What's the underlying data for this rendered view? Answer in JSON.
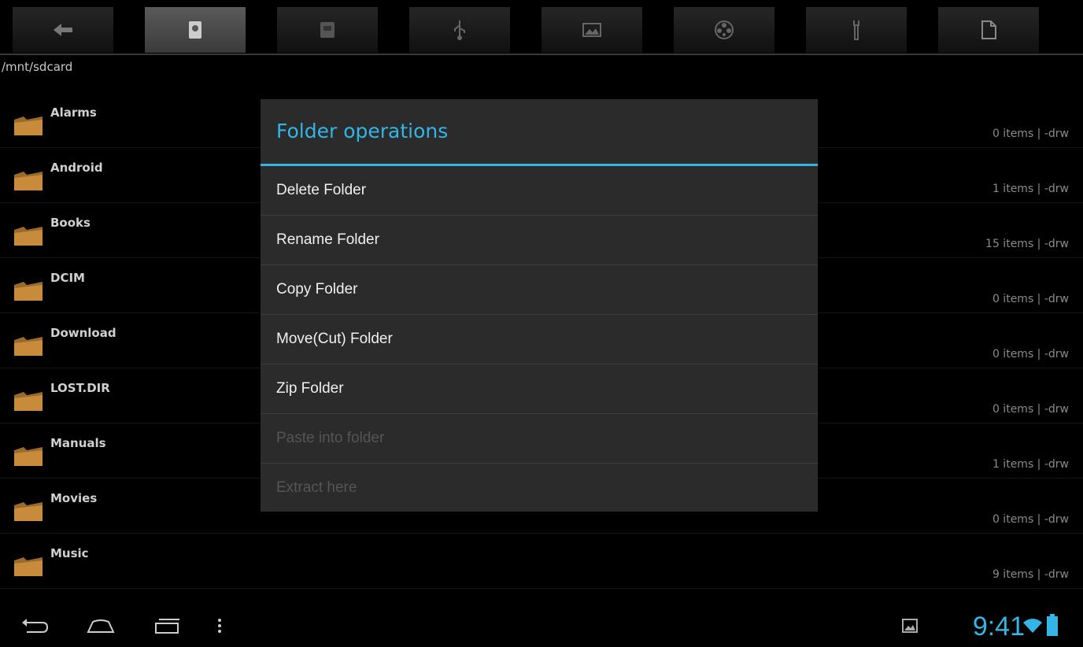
{
  "toolbar": {
    "icons": [
      "back-arrow-icon",
      "sdcard-icon",
      "storage-card-icon",
      "usb-icon",
      "image-icon",
      "film-reel-icon",
      "tools-icon",
      "document-icon"
    ]
  },
  "path": "/mnt/sdcard",
  "folders": [
    {
      "name": "Alarms",
      "meta": "0 items | -drw"
    },
    {
      "name": "Android",
      "meta": "1 items | -drw"
    },
    {
      "name": "Books",
      "meta": "15 items | -drw"
    },
    {
      "name": "DCIM",
      "meta": "0 items | -drw"
    },
    {
      "name": "Download",
      "meta": "0 items | -drw"
    },
    {
      "name": "LOST.DIR",
      "meta": "0 items | -drw"
    },
    {
      "name": "Manuals",
      "meta": "1 items | -drw"
    },
    {
      "name": "Movies",
      "meta": "0 items | -drw"
    },
    {
      "name": "Music",
      "meta": "9 items | -drw"
    }
  ],
  "dialog": {
    "title": "Folder operations",
    "items": [
      {
        "label": "Delete Folder",
        "enabled": true
      },
      {
        "label": "Rename Folder",
        "enabled": true
      },
      {
        "label": "Copy Folder",
        "enabled": true
      },
      {
        "label": "Move(Cut) Folder",
        "enabled": true
      },
      {
        "label": "Zip Folder",
        "enabled": true
      },
      {
        "label": "Paste into folder",
        "enabled": false
      },
      {
        "label": "Extract here",
        "enabled": false
      }
    ]
  },
  "statusbar": {
    "time": "9:41",
    "accent": "#33b5e5"
  }
}
